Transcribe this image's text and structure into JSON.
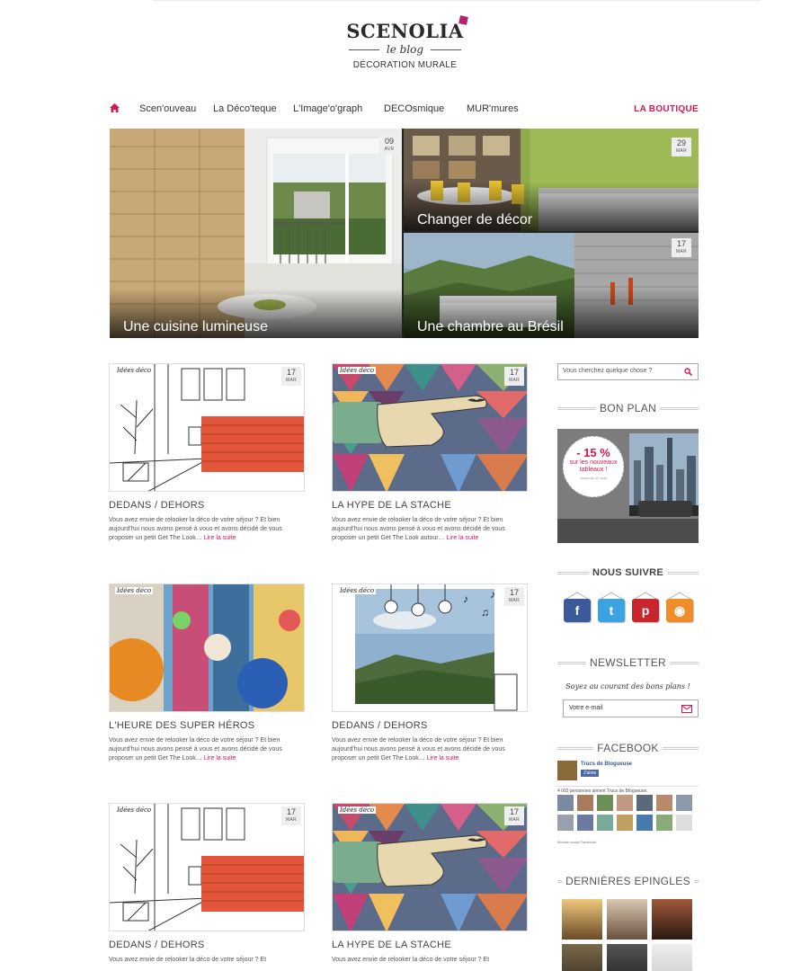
{
  "logo": {
    "name": "SCENOLIA",
    "sub": "le blog",
    "tagline": "DÉCORATION MURALE"
  },
  "nav": {
    "items": [
      "Scen'ouveau",
      "La Déco'teque",
      "L'Image'o'graph",
      "DECOsmique",
      "MUR'mures"
    ],
    "shop": "LA BOUTIQUE",
    "accent": "#d6174f"
  },
  "hero": {
    "main": {
      "caption": "Une cuisine lumineuse",
      "day": "09",
      "month": "AVR"
    },
    "top_right": {
      "caption": "Changer de décor",
      "day": "29",
      "month": "MAR"
    },
    "bottom_right": {
      "caption": "Une chambre au Brésil",
      "day": "17",
      "month": "MAR"
    }
  },
  "posts": [
    {
      "title": "DEDANS / DEHORS",
      "excerpt": "Vous avez envie de relooker la déco de votre séjour ? Et bien aujourd'hui nous avons pensé à vous et avons décidé de vous proposer un petit Get The Look…",
      "more": "Lire la suite",
      "day": "17",
      "month": "MAR",
      "badge": "Idées déco"
    },
    {
      "title": "LA HYPE DE LA STACHE",
      "excerpt": "Vous avez envie de relooker la déco de votre séjour ? Et bien aujourd'hui nous avons pensé à vous et avons décidé de vous proposer un petit Get The Look autour…",
      "more": "Lire la suite",
      "day": "17",
      "month": "MAR",
      "badge": "Idées déco"
    },
    {
      "title": "L'HEURE DES SUPER HÉROS",
      "excerpt": "Vous avez envie de relooker la déco de votre séjour ? Et bien  aujourd'hui nous avons pensé à vous et avons décidé de vous proposer un petit Get The Look…",
      "more": "Lire la suite",
      "day": "",
      "month": "",
      "badge": "Idées déco"
    },
    {
      "title": "DEDANS / DEHORS",
      "excerpt": "Vous avez envie de relooker la déco de votre séjour ? Et bien  aujourd'hui nous avons pensé à vous et avons décidé de vous proposer un petit Get The Look…",
      "more": "Lire la suite",
      "day": "17",
      "month": "MAR",
      "badge": "Idées déco"
    },
    {
      "title": "DEDANS / DEHORS",
      "excerpt": "Vous avez envie de relooker la déco de votre séjour ? Et",
      "more": "",
      "day": "17",
      "month": "MAR",
      "badge": "Idées déco"
    },
    {
      "title": "LA HYPE DE LA STACHE",
      "excerpt": "Vous avez envie de relooker la déco de votre séjour ? Et",
      "more": "",
      "day": "17",
      "month": "MAR",
      "badge": "Idées déco"
    }
  ],
  "sidebar": {
    "search_placeholder": "Vous cherchez quelque chose ?",
    "bon_plan": {
      "title": "BON PLAN",
      "discount": "- 15 %",
      "promo": "sur les nouveaux tableaux !",
      "small": "Jusqu'au 30 avril"
    },
    "follow": {
      "title": "NOUS SUIVRE",
      "networks": [
        "facebook-icon",
        "twitter-icon",
        "pinterest-icon",
        "rss-icon"
      ]
    },
    "newsletter": {
      "title": "NEWSLETTER",
      "text": "Soyez au courant des bons plans !",
      "placeholder": "Votre e-mail"
    },
    "facebook": {
      "title": "FACEBOOK",
      "page": "Trucs de Blogueuse",
      "like": "J'aime",
      "fans": "4 003 personnes aiment Trucs de Blogueuse.",
      "plugin": "Module social Facebook"
    },
    "pins": {
      "title": "DERNIÈRES EPINGLES"
    }
  }
}
